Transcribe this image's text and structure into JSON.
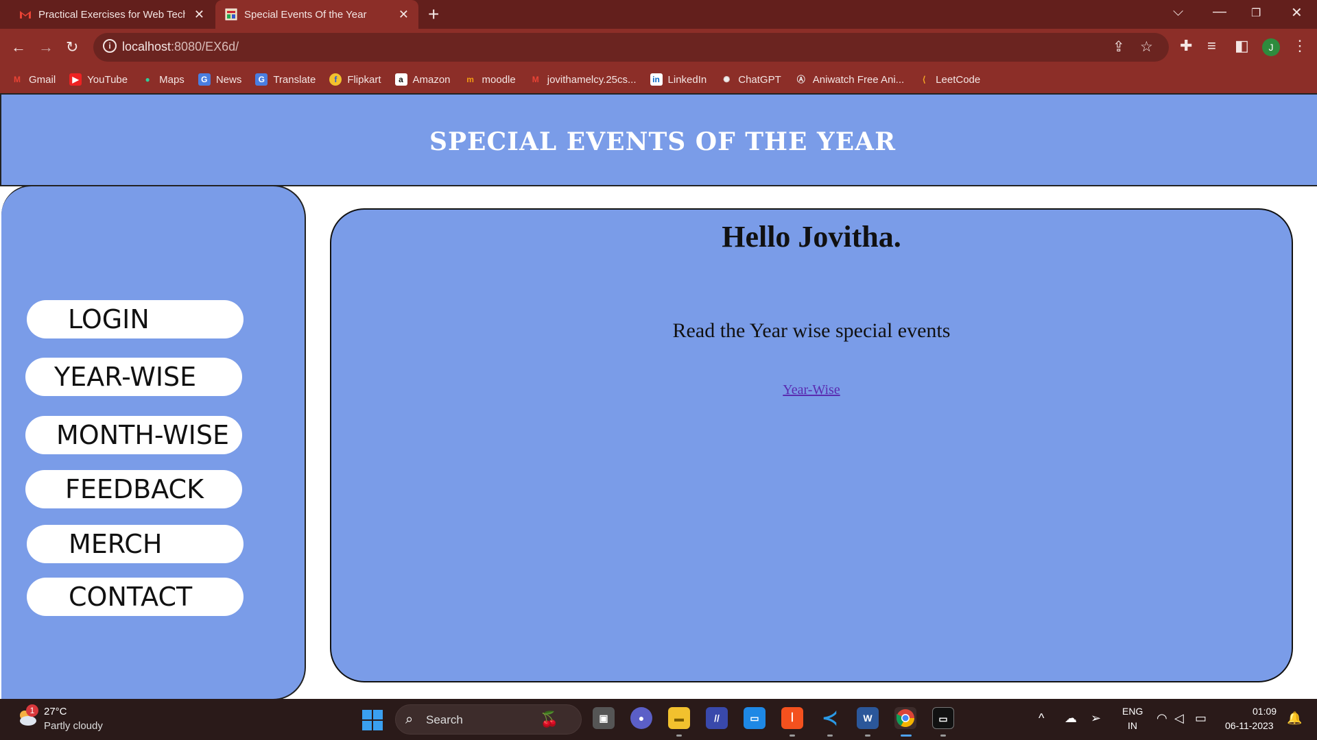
{
  "browser": {
    "tabs": [
      {
        "title": "Practical Exercises for Web Techr",
        "active": false
      },
      {
        "title": "Special Events Of the Year",
        "active": true
      }
    ],
    "url_host": "localhost",
    "url_rest": ":8080/EX6d/",
    "profile_initial": "J",
    "bookmarks": [
      "Gmail",
      "YouTube",
      "Maps",
      "News",
      "Translate",
      "Flipkart",
      "Amazon",
      "moodle",
      "jovithamelcy.25cs...",
      "LinkedIn",
      "ChatGPT",
      "Aniwatch Free Ani...",
      "LeetCode"
    ]
  },
  "page": {
    "title": "SPECIAL EVENTS OF THE YEAR",
    "nav": [
      "LOGIN",
      "YEAR-WISE",
      "MONTH-WISE",
      "FEEDBACK",
      "MERCH",
      "CONTACT"
    ],
    "greeting": "Hello Jovitha.",
    "subtext": "Read the Year wise special events",
    "link_label": "Year-Wise",
    "colors": {
      "panel": "#7a9ce8",
      "link": "#5a2bb0"
    }
  },
  "taskbar": {
    "weather_badge": "1",
    "temperature": "27°C",
    "condition": "Partly cloudy",
    "search_label": "Search",
    "lang_1": "ENG",
    "lang_2": "IN",
    "time": "01:09",
    "date": "06-11-2023"
  }
}
